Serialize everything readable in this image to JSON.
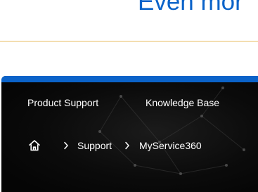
{
  "heading": {
    "text": "Even mor"
  },
  "nav": {
    "items": [
      {
        "label": "Product Support"
      },
      {
        "label": "Knowledge Base"
      }
    ]
  },
  "breadcrumb": {
    "home_icon": "home-icon",
    "separator_icon": "chevron-right-icon",
    "items": [
      {
        "label": "Support"
      },
      {
        "label": "MyService360"
      }
    ]
  },
  "colors": {
    "heading": "#0b63c9",
    "divider": "#e6b54f",
    "panel_bg": "#0b0b0b",
    "accent_bar": "#0b63c9",
    "panel_text": "#ffffff"
  }
}
